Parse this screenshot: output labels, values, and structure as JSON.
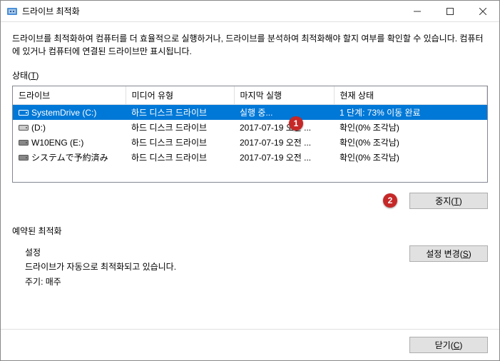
{
  "window": {
    "title": "드라이브 최적화"
  },
  "description": "드라이브를 최적화하여 컴퓨터를 더 효율적으로 실행하거나, 드라이브를 분석하여 최적화해야 할지 여부를 확인할 수 있습니다. 컴퓨터에 있거나 컴퓨터에 연결된 드라이브만 표시됩니다.",
  "status_label_prefix": "상태(",
  "status_label_underline": "T",
  "status_label_suffix": ")",
  "columns": {
    "drive": "드라이브",
    "media": "미디어 유형",
    "last": "마지막 실행",
    "state": "현재 상태"
  },
  "rows": [
    {
      "drive": "SystemDrive (C:)",
      "media": "하드 디스크 드라이브",
      "last": "실행 중...",
      "state": "1 단계: 73% 이동 완료",
      "selected": true,
      "icon": "drive-blue"
    },
    {
      "drive": "(D:)",
      "media": "하드 디스크 드라이브",
      "last": "2017-07-19 오전 ...",
      "state": "확인(0% 조각남)",
      "selected": false,
      "icon": "drive-gray"
    },
    {
      "drive": "W10ENG (E:)",
      "media": "하드 디스크 드라이브",
      "last": "2017-07-19 오전 ...",
      "state": "확인(0% 조각남)",
      "selected": false,
      "icon": "drive-dark"
    },
    {
      "drive": "システムで予約済み",
      "media": "하드 디스크 드라이브",
      "last": "2017-07-19 오전 ...",
      "state": "확인(0% 조각남)",
      "selected": false,
      "icon": "drive-dark"
    }
  ],
  "buttons": {
    "stop_prefix": "중지(",
    "stop_underline": "T",
    "stop_suffix": ")",
    "change_prefix": "설정 변경(",
    "change_underline": "S",
    "change_suffix": ")",
    "close_prefix": "닫기(",
    "close_underline": "C",
    "close_suffix": ")"
  },
  "scheduled": {
    "title": "예약된 최적화",
    "settings_label": "설정",
    "auto_text": "드라이브가 자동으로 최적화되고 있습니다.",
    "cycle_text": "주기: 매주"
  },
  "markers": {
    "m1": "1",
    "m2": "2"
  }
}
